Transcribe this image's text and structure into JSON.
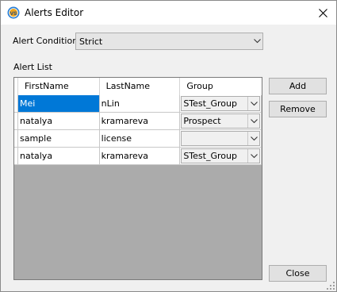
{
  "window": {
    "title": "Alerts Editor",
    "icon": "vs-app-icon"
  },
  "alert_condition": {
    "label": "Alert Condition",
    "value": "Strict"
  },
  "alert_list": {
    "label": "Alert List",
    "columns": [
      "FirstName",
      "LastName",
      "Group"
    ],
    "rows": [
      {
        "first": "Mei",
        "last": "nLin",
        "group": "STest_Group",
        "selected": true
      },
      {
        "first": "natalya",
        "last": "kramareva",
        "group": "Prospect"
      },
      {
        "first": "sample",
        "last": "license",
        "group": ""
      },
      {
        "first": "natalya",
        "last": "kramareva",
        "group": "STest_Group"
      }
    ]
  },
  "buttons": {
    "add": "Add",
    "remove": "Remove",
    "close": "Close"
  },
  "colors": {
    "selection": "#0078d7",
    "grid_empty": "#ababab"
  }
}
